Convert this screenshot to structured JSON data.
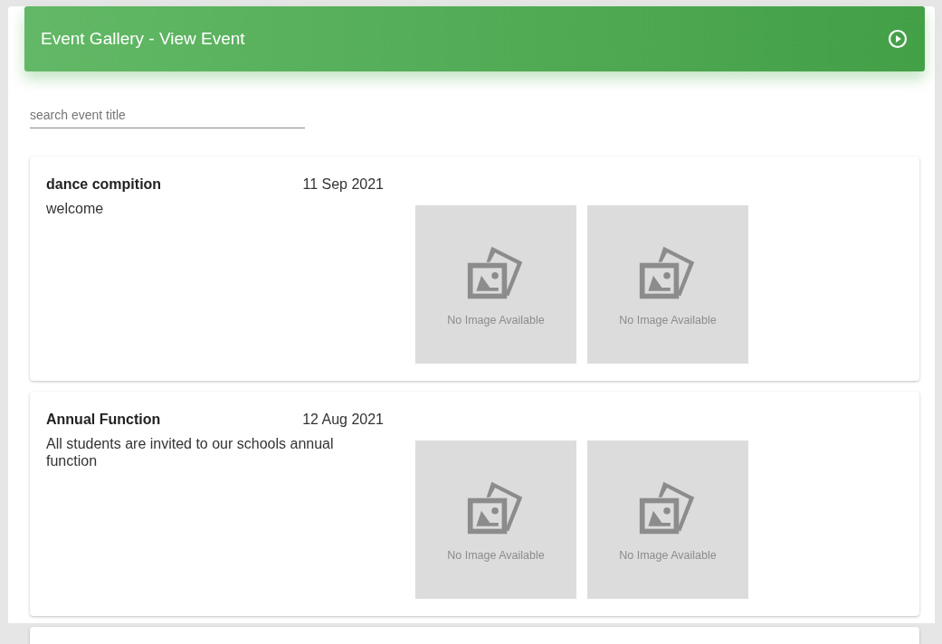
{
  "header": {
    "title": "Event Gallery - View Event"
  },
  "search": {
    "placeholder": "search event title"
  },
  "events": [
    {
      "title": "dance compition",
      "date": "11 Sep 2021",
      "description": "welcome",
      "images": [
        "No Image Available",
        "No Image Available"
      ]
    },
    {
      "title": "Annual Function",
      "date": "12 Aug 2021",
      "description": "All students are invited to our schools annual function",
      "images": [
        "No Image Available",
        "No Image Available"
      ]
    }
  ]
}
